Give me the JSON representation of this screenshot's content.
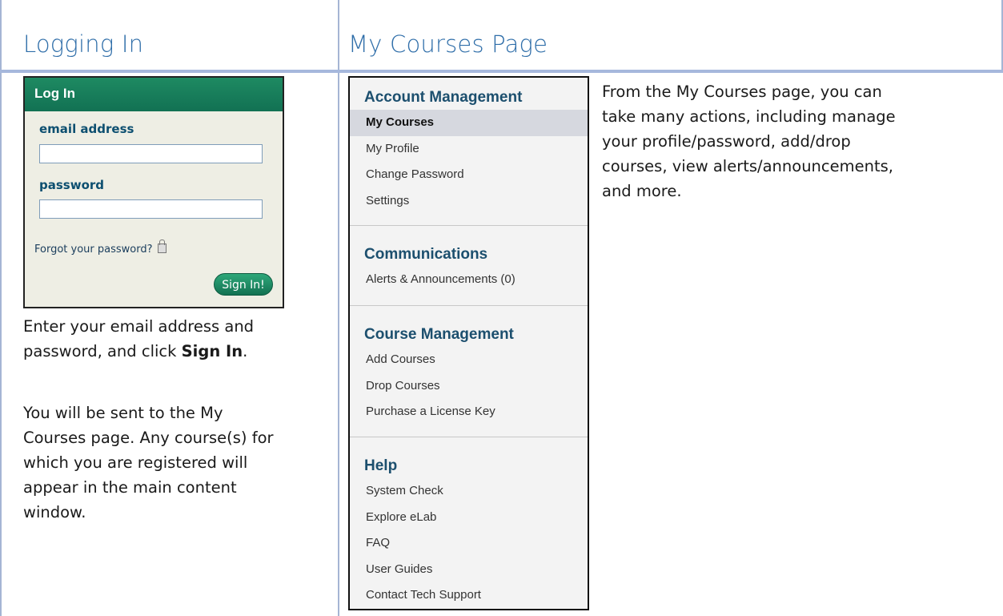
{
  "left_column": {
    "title": "Logging In",
    "login_box": {
      "header": "Log In",
      "email_label": "email address",
      "email_value": "",
      "password_label": "password",
      "password_value": "",
      "forgot_link": "Forgot your password?",
      "forgot_icon": "lock-icon",
      "sign_in_button": "Sign In!"
    },
    "instructions": {
      "line1": "Enter your email address and",
      "line2_prefix": "password, and click ",
      "line2_bold": "Sign In",
      "line2_suffix": ".",
      "para2": [
        "You will be sent to the My",
        "Courses page. Any course(s) for",
        "which you are registered will",
        "appear in the main content",
        "window."
      ]
    }
  },
  "right_column": {
    "title": "My Courses Page",
    "menu": {
      "sections": [
        {
          "heading": "Account Management",
          "items": [
            "My Courses",
            "My Profile",
            "Change Password",
            "Settings"
          ],
          "active": "My Courses"
        },
        {
          "heading": "Communications",
          "items": [
            "Alerts & Announcements (0)"
          ]
        },
        {
          "heading": "Course Management",
          "items": [
            "Add Courses",
            "Drop Courses",
            "Purchase a License Key"
          ]
        },
        {
          "heading": "Help",
          "items": [
            "System Check",
            "Explore eLab",
            "FAQ",
            "User Guides",
            "Contact Tech Support"
          ]
        }
      ]
    },
    "description": [
      "From the My Courses page, you can",
      "take many actions, including manage",
      "your profile/password, add/drop",
      "courses, view alerts/announcements,",
      "and more."
    ]
  },
  "colors": {
    "title": "#2f6ea9",
    "rule": "#a6b8dc",
    "login_header": "#1a7e5c",
    "menu_heading": "#1c4f6e"
  }
}
